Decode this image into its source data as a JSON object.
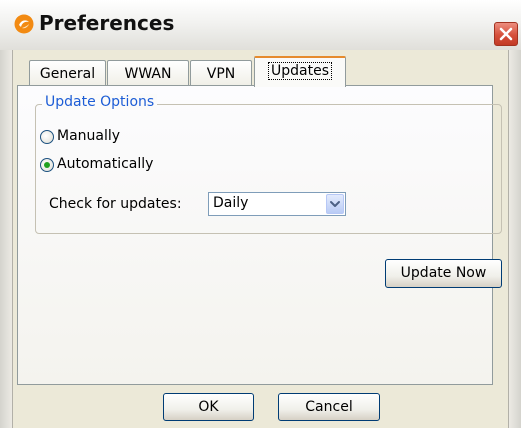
{
  "window": {
    "title": "Preferences",
    "icon": "app-logo-icon",
    "close_icon": "close-icon"
  },
  "tabs": [
    {
      "label": "General",
      "active": false
    },
    {
      "label": "WWAN",
      "active": false
    },
    {
      "label": "VPN",
      "active": false
    },
    {
      "label": "Updates",
      "active": true
    }
  ],
  "update_options": {
    "group_label": "Update Options",
    "radio_manual": {
      "label": "Manually",
      "checked": false
    },
    "radio_auto": {
      "label": "Automatically",
      "checked": true
    },
    "check_label": "Check for updates:",
    "frequency_value": "Daily"
  },
  "buttons": {
    "update_now": "Update Now",
    "ok": "OK",
    "cancel": "Cancel"
  },
  "colors": {
    "accent_tab": "#e68b2c",
    "group_label": "#1d5dd6",
    "close_red": "#d6503b",
    "radio_dot": "#21a121"
  }
}
